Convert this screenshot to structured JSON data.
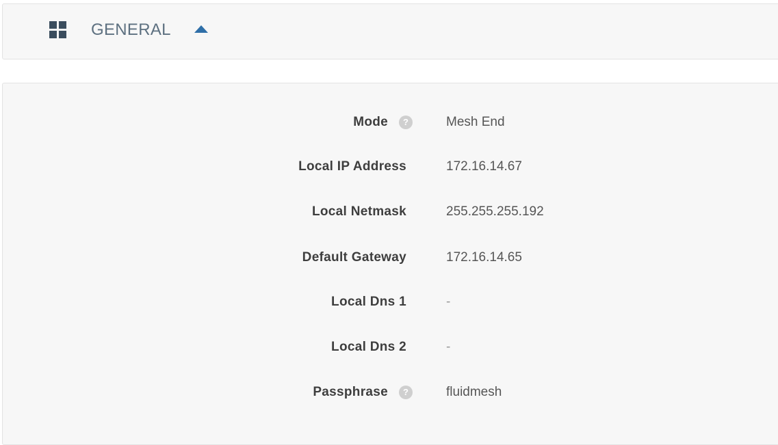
{
  "section": {
    "title": "GENERAL",
    "icon": "grid-icon",
    "toggle_icon": "caret-up-icon",
    "accent_color": "#2f6fa8"
  },
  "fields": [
    {
      "label": "Mode",
      "value": "Mesh End",
      "help": true
    },
    {
      "label": "Local IP Address",
      "value": "172.16.14.67",
      "help": false
    },
    {
      "label": "Local Netmask",
      "value": "255.255.255.192",
      "help": false
    },
    {
      "label": "Default Gateway",
      "value": "172.16.14.65",
      "help": false
    },
    {
      "label": "Local Dns 1",
      "value": "-",
      "help": false
    },
    {
      "label": "Local Dns 2",
      "value": "-",
      "help": false
    },
    {
      "label": "Passphrase",
      "value": "fluidmesh",
      "help": true
    }
  ],
  "help_glyph": "?"
}
